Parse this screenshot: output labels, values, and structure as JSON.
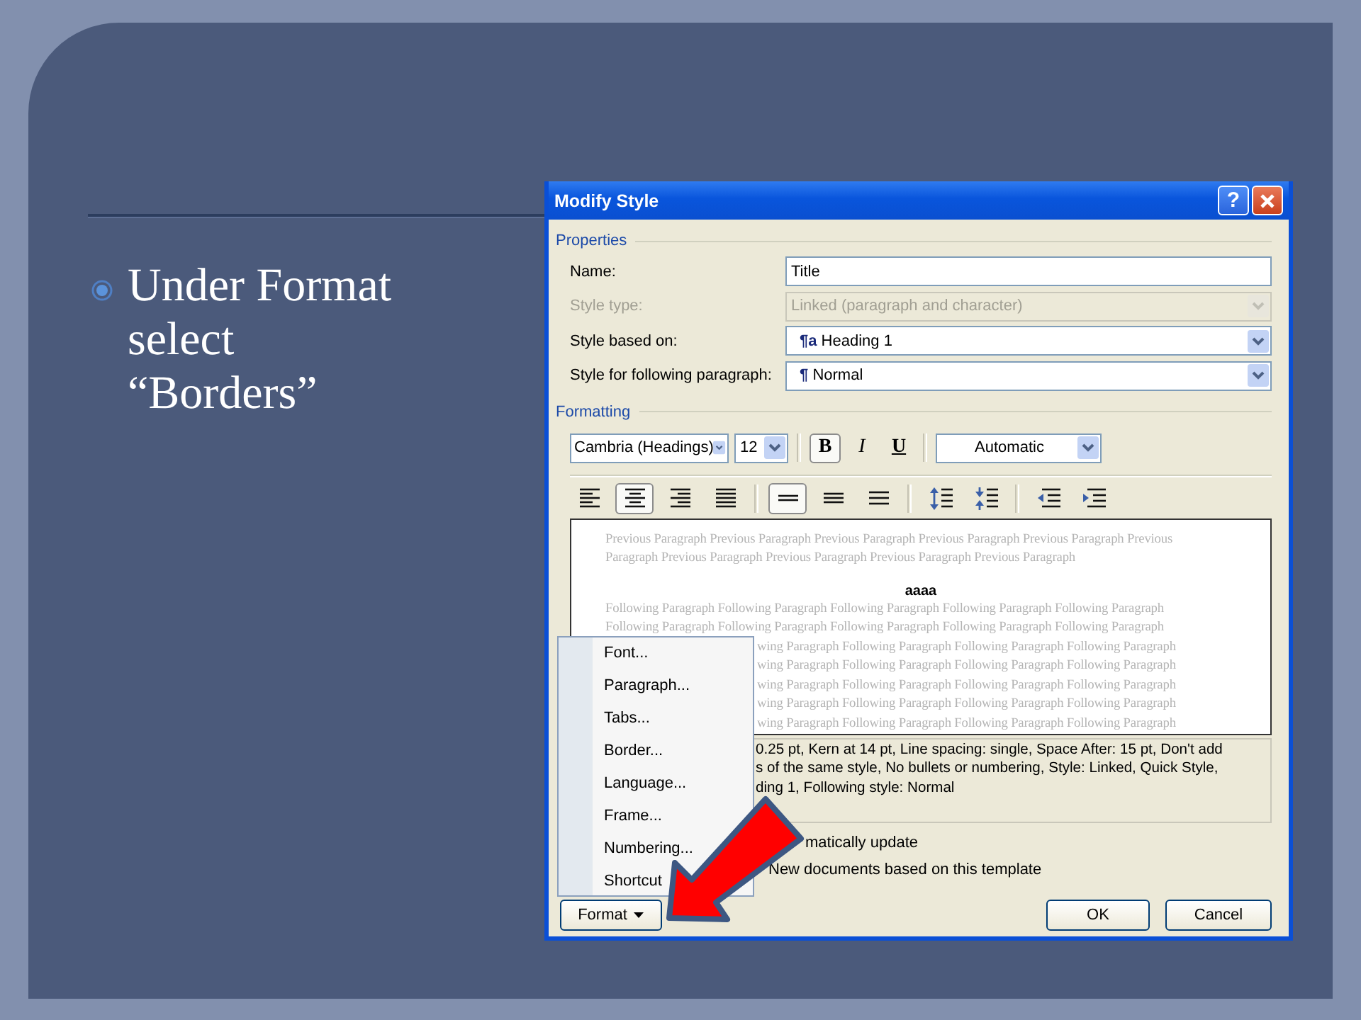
{
  "slide": {
    "bullet_text": "Under Format select “Borders”"
  },
  "dialog": {
    "title": "Modify Style",
    "help_button": "?",
    "properties": {
      "label": "Properties",
      "fields": [
        {
          "label": "Name:",
          "kind": "text",
          "value": "Title",
          "disabled": false
        },
        {
          "label": "Style type:",
          "kind": "combo",
          "value": "Linked (paragraph and character)",
          "disabled": true
        },
        {
          "label": "Style based on:",
          "kind": "combo",
          "prefix": "¶a",
          "value": "Heading 1",
          "disabled": false
        },
        {
          "label": "Style for following paragraph:",
          "kind": "combo",
          "prefix": "¶",
          "value": "Normal",
          "disabled": false
        }
      ]
    },
    "formatting": {
      "label": "Formatting",
      "font": "Cambria (Headings)",
      "size": "12",
      "styles": [
        {
          "label": "B",
          "kind": "bold",
          "selected": true
        },
        {
          "label": "I",
          "kind": "italic",
          "selected": false
        },
        {
          "label": "U",
          "kind": "underline",
          "selected": false
        }
      ],
      "font_color": "Automatic",
      "alignment": [
        {
          "kind": "left",
          "selected": false
        },
        {
          "kind": "center",
          "selected": true
        },
        {
          "kind": "right",
          "selected": false
        },
        {
          "kind": "justify",
          "selected": false
        }
      ],
      "line_spacing": [
        {
          "kind": "single",
          "selected": true
        },
        {
          "kind": "one-half",
          "selected": false
        },
        {
          "kind": "double",
          "selected": false
        }
      ],
      "paragraph_spacing": [
        {
          "kind": "increase"
        },
        {
          "kind": "decrease"
        }
      ],
      "indent": [
        {
          "kind": "decrease"
        },
        {
          "kind": "increase"
        }
      ]
    },
    "preview": {
      "previous_lines": [
        "Previous Paragraph Previous Paragraph Previous Paragraph Previous Paragraph Previous Paragraph Previous",
        "Paragraph Previous Paragraph Previous Paragraph Previous Paragraph Previous Paragraph"
      ],
      "sample": "aaaa",
      "following_lines": [
        "Following Paragraph Following Paragraph Following Paragraph Following Paragraph Following Paragraph",
        "Following Paragraph Following Paragraph Following Paragraph Following Paragraph Following Paragraph"
      ],
      "following_lines_beside_menu": [
        "wing Paragraph Following Paragraph Following Paragraph Following Paragraph",
        "wing Paragraph Following Paragraph Following Paragraph Following Paragraph",
        "wing Paragraph Following Paragraph Following Paragraph Following Paragraph",
        "wing Paragraph Following Paragraph Following Paragraph Following Paragraph",
        "wing Paragraph Following Paragraph Following Paragraph Following Paragraph"
      ]
    },
    "description_lines": [
      "0.25 pt, Kern at 14 pt, Line spacing:  single, Space After:  15 pt, Don't add",
      "s of the same style,  No bullets or numbering, Style: Linked, Quick Style,",
      "ding 1, Following style: Normal"
    ],
    "options": [
      "matically update",
      "New documents based on this template"
    ],
    "format_menu": [
      "Font...",
      "Paragraph...",
      "Tabs...",
      "Border...",
      "Language...",
      "Frame...",
      "Numbering...",
      "Shortcut"
    ],
    "buttons": {
      "format": "Format",
      "ok": "OK",
      "cancel": "Cancel"
    }
  }
}
